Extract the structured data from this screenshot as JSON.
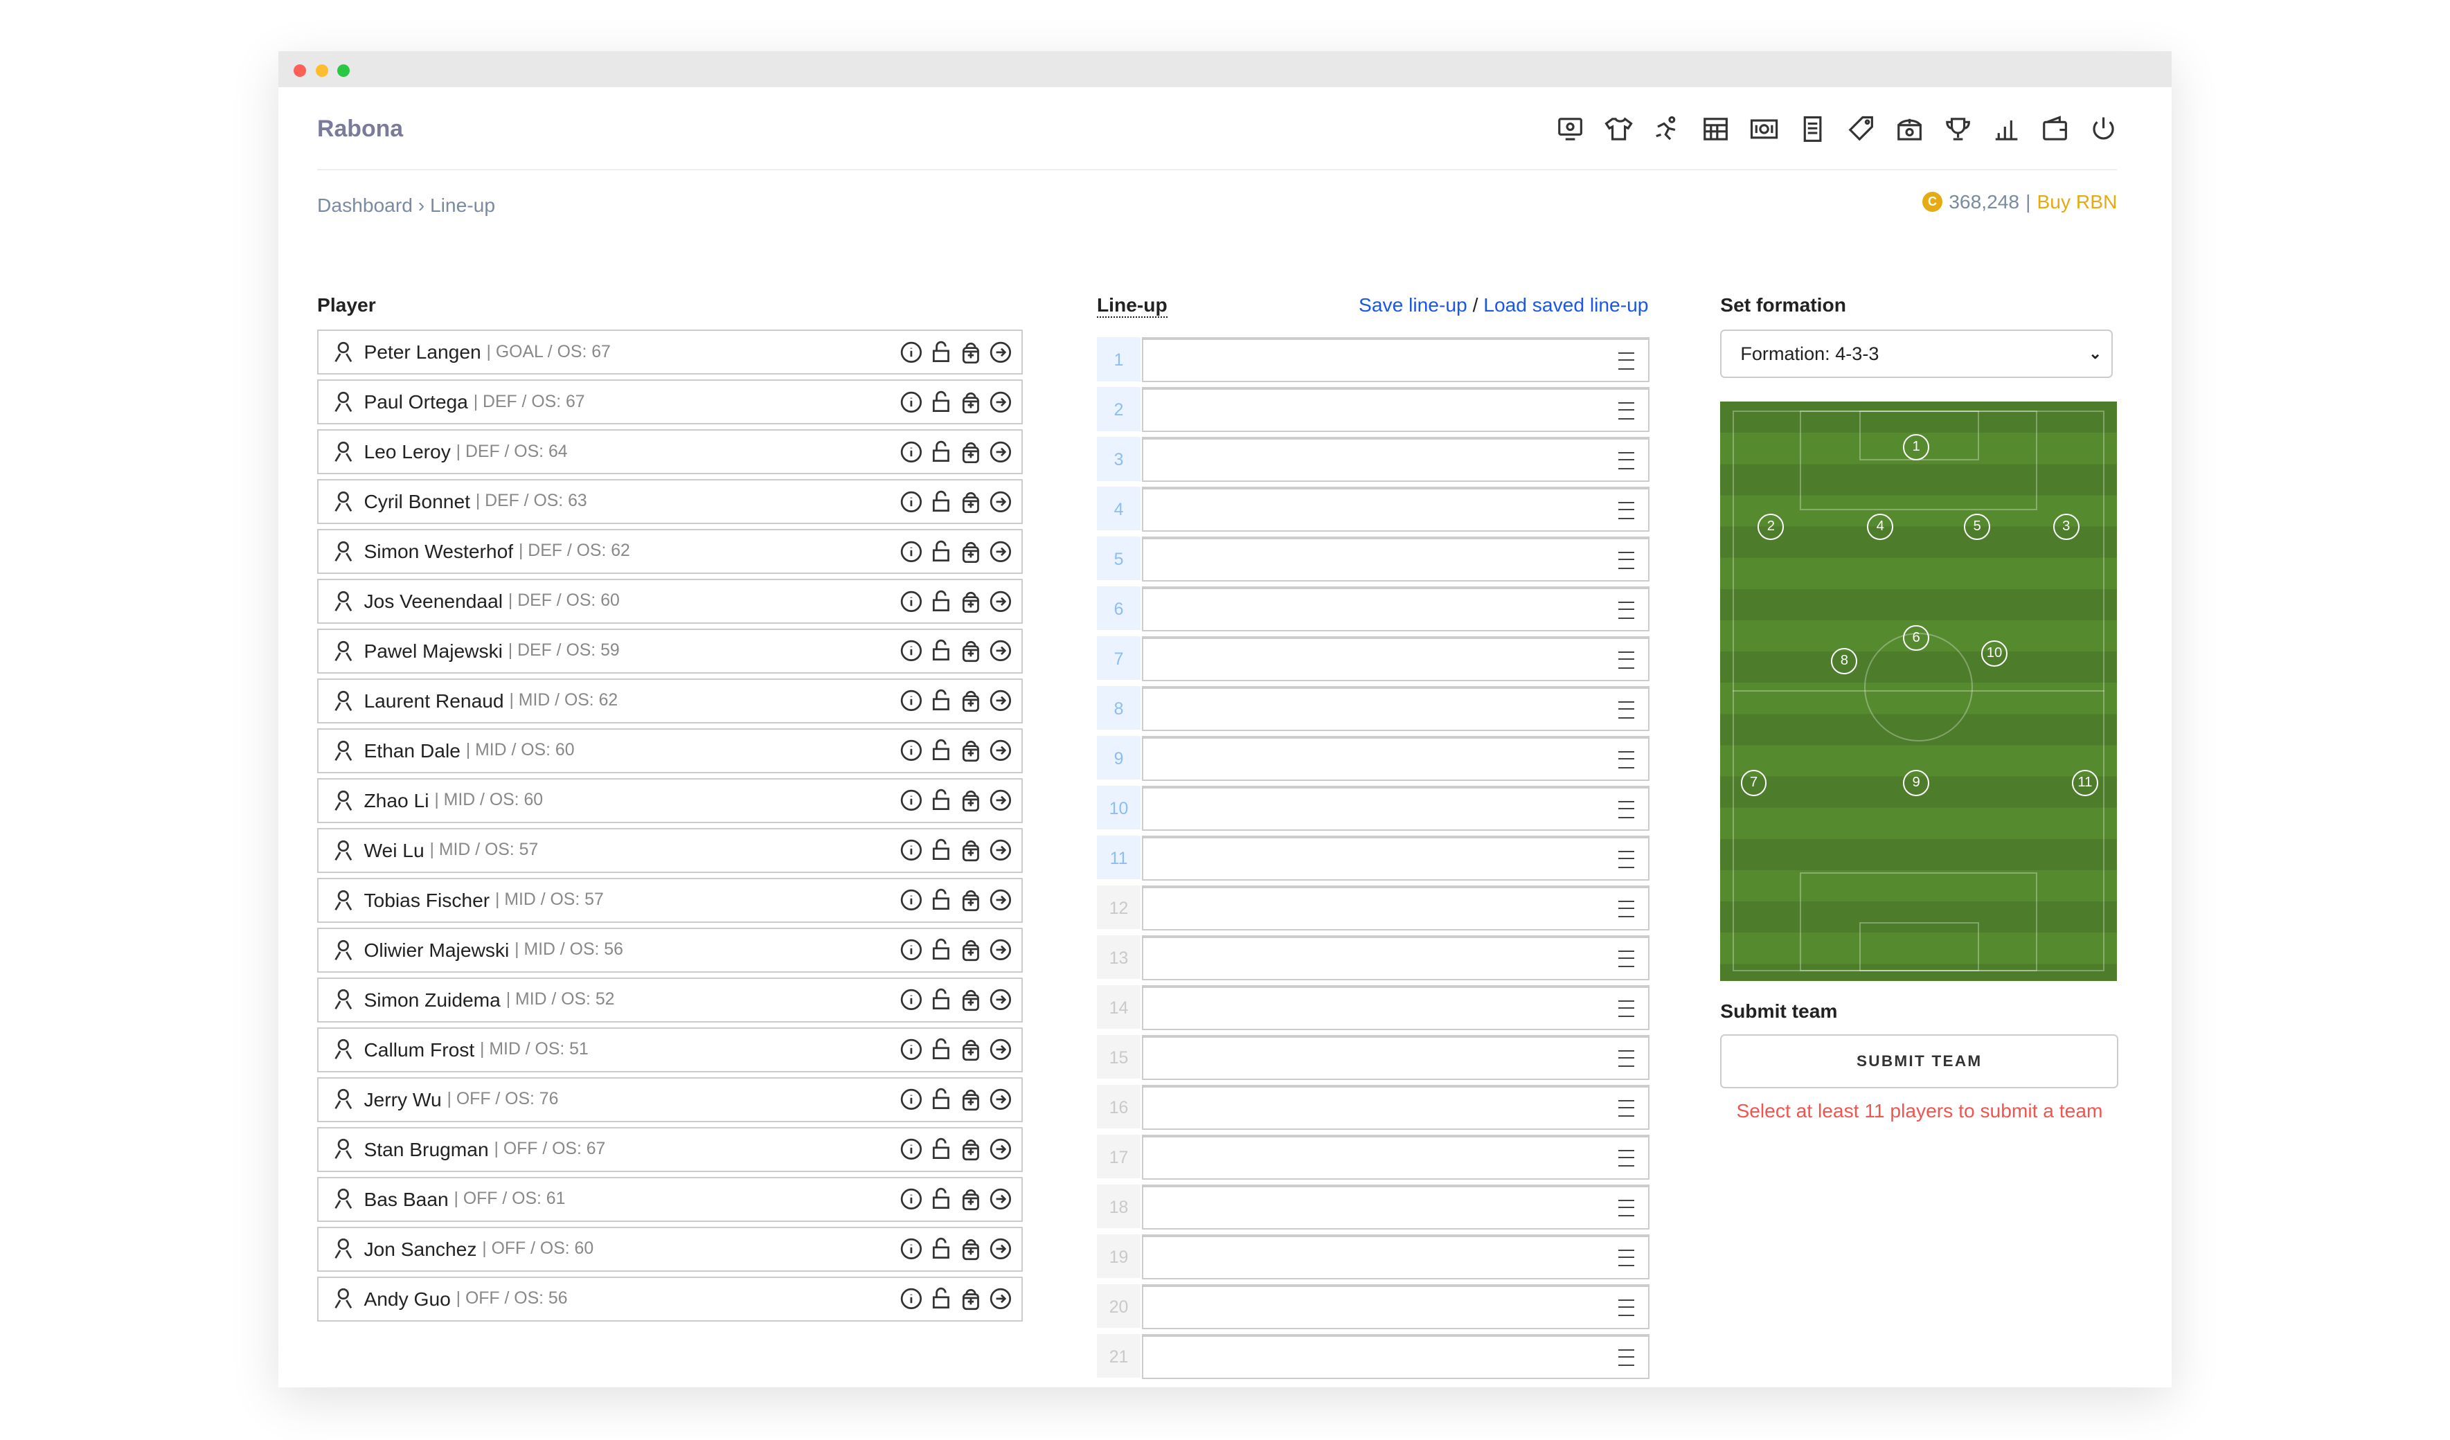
{
  "app": {
    "title": "Rabona"
  },
  "nav_icons": [
    "dashboard-icon",
    "shirt-icon",
    "training-icon",
    "calendar-icon",
    "cash-icon",
    "document-icon",
    "tag-icon",
    "stadium-icon",
    "trophy-icon",
    "chart-icon",
    "wallet-icon",
    "power-icon"
  ],
  "breadcrumb": {
    "text": "Dashboard › Line-up"
  },
  "balance": {
    "coin": "C",
    "amount": "368,248",
    "sep": "|",
    "buy_label": "Buy RBN"
  },
  "players": {
    "heading": "Player",
    "items": [
      {
        "name": "Peter Langen",
        "meta": "| GOAL / OS: 67"
      },
      {
        "name": "Paul Ortega",
        "meta": "| DEF / OS: 67"
      },
      {
        "name": "Leo Leroy",
        "meta": "| DEF / OS: 64"
      },
      {
        "name": "Cyril Bonnet",
        "meta": "| DEF / OS: 63"
      },
      {
        "name": "Simon Westerhof",
        "meta": "| DEF / OS: 62"
      },
      {
        "name": "Jos Veenendaal",
        "meta": "| DEF / OS: 60"
      },
      {
        "name": "Pawel Majewski",
        "meta": "| DEF / OS: 59"
      },
      {
        "name": "Laurent Renaud",
        "meta": "| MID / OS: 62"
      },
      {
        "name": "Ethan Dale",
        "meta": "| MID / OS: 60"
      },
      {
        "name": "Zhao Li",
        "meta": "| MID / OS: 60"
      },
      {
        "name": "Wei Lu",
        "meta": "| MID / OS: 57"
      },
      {
        "name": "Tobias Fischer",
        "meta": "| MID / OS: 57"
      },
      {
        "name": "Oliwier Majewski",
        "meta": "| MID / OS: 56"
      },
      {
        "name": "Simon Zuidema",
        "meta": "| MID / OS: 52"
      },
      {
        "name": "Callum Frost",
        "meta": "| MID / OS: 51"
      },
      {
        "name": "Jerry Wu",
        "meta": "| OFF / OS: 76"
      },
      {
        "name": "Stan Brugman",
        "meta": "| OFF / OS: 67"
      },
      {
        "name": "Bas Baan",
        "meta": "| OFF / OS: 61"
      },
      {
        "name": "Jon Sanchez",
        "meta": "| OFF / OS: 60"
      },
      {
        "name": "Andy Guo",
        "meta": "| OFF / OS: 56"
      }
    ]
  },
  "lineup": {
    "heading": "Line-up",
    "save_label": "Save line-up",
    "sep": "/",
    "load_label": "Load saved line-up",
    "slots": [
      "1",
      "2",
      "3",
      "4",
      "5",
      "6",
      "7",
      "8",
      "9",
      "10",
      "11",
      "12",
      "13",
      "14",
      "15",
      "16",
      "17",
      "18",
      "19",
      "20",
      "21"
    ],
    "starters": 11
  },
  "formation": {
    "heading": "Set formation",
    "selected": "Formation: 4-3-3",
    "positions": [
      "1",
      "2",
      "3",
      "4",
      "5",
      "6",
      "7",
      "8",
      "9",
      "10",
      "11"
    ]
  },
  "submit": {
    "heading": "Submit team",
    "button": "SUBMIT TEAM",
    "error": "Select at least 11 players to submit a team"
  },
  "colors": {
    "accent": "#1a56e8",
    "coin": "#e5ab12",
    "error": "#f0564f",
    "pitch": "#4d7c2a"
  }
}
